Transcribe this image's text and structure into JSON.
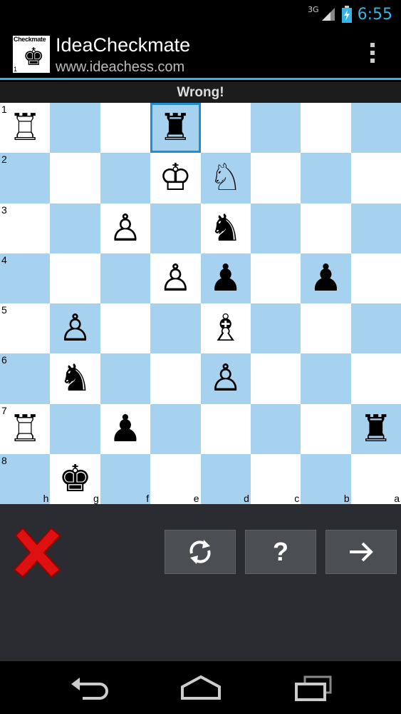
{
  "status": {
    "network": "3G",
    "time": "6:55"
  },
  "app": {
    "title": "IdeaCheckmate",
    "subtitle": "www.ideachess.com",
    "logo_text": "Checkmate",
    "logo_number": "1",
    "logo_glyph": "♚"
  },
  "result": "Wrong!",
  "board": {
    "ranks": [
      "1",
      "2",
      "3",
      "4",
      "5",
      "6",
      "7",
      "8"
    ],
    "files": [
      "h",
      "g",
      "f",
      "e",
      "d",
      "c",
      "b",
      "a"
    ],
    "selected": [
      0,
      3
    ],
    "pieces": [
      [
        0,
        0,
        "♖"
      ],
      [
        0,
        3,
        "♜"
      ],
      [
        1,
        3,
        "♔"
      ],
      [
        1,
        4,
        "♘"
      ],
      [
        2,
        2,
        "♙"
      ],
      [
        2,
        4,
        "♞"
      ],
      [
        3,
        3,
        "♙"
      ],
      [
        3,
        4,
        "♟"
      ],
      [
        3,
        6,
        "♟"
      ],
      [
        4,
        1,
        "♙"
      ],
      [
        4,
        4,
        "♗"
      ],
      [
        5,
        1,
        "♞"
      ],
      [
        5,
        4,
        "♙"
      ],
      [
        6,
        0,
        "♖"
      ],
      [
        6,
        2,
        "♟"
      ],
      [
        6,
        7,
        "♜"
      ],
      [
        7,
        1,
        "♚"
      ]
    ]
  },
  "controls": {
    "help_label": "?",
    "icons": [
      "wrong-x-icon",
      "refresh-icon",
      "help-icon",
      "arrow-right-icon"
    ]
  },
  "colors": {
    "accent": "#33b5e5",
    "light_square": "#ffffff",
    "dark_square": "#a6d2f0",
    "panel": "#2a2c31",
    "button": "#4b4e53"
  }
}
